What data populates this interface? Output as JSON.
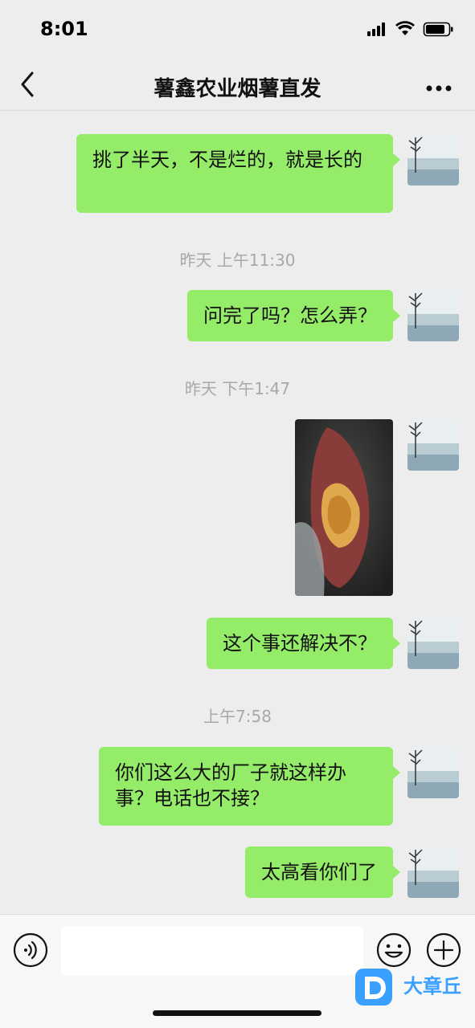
{
  "status": {
    "time": "8:01"
  },
  "nav": {
    "title": "薯鑫农业烟薯直发"
  },
  "messages": [
    {
      "text": "挑了半天，不是烂的，就是长的"
    },
    {
      "text": "问完了吗？怎么弄？"
    },
    {
      "text": "这个事还解决不？"
    },
    {
      "text": "你们这么大的厂子就这样办事？电话也不接？"
    },
    {
      "text": "太高看你们了"
    }
  ],
  "timestamps": [
    "昨天 上午11:30",
    "昨天 下午1:47",
    "上午7:58"
  ],
  "input": {
    "value": ""
  },
  "watermark": {
    "text": "大章丘"
  },
  "colors": {
    "bubble": "#95ec69",
    "background": "#ededed"
  }
}
